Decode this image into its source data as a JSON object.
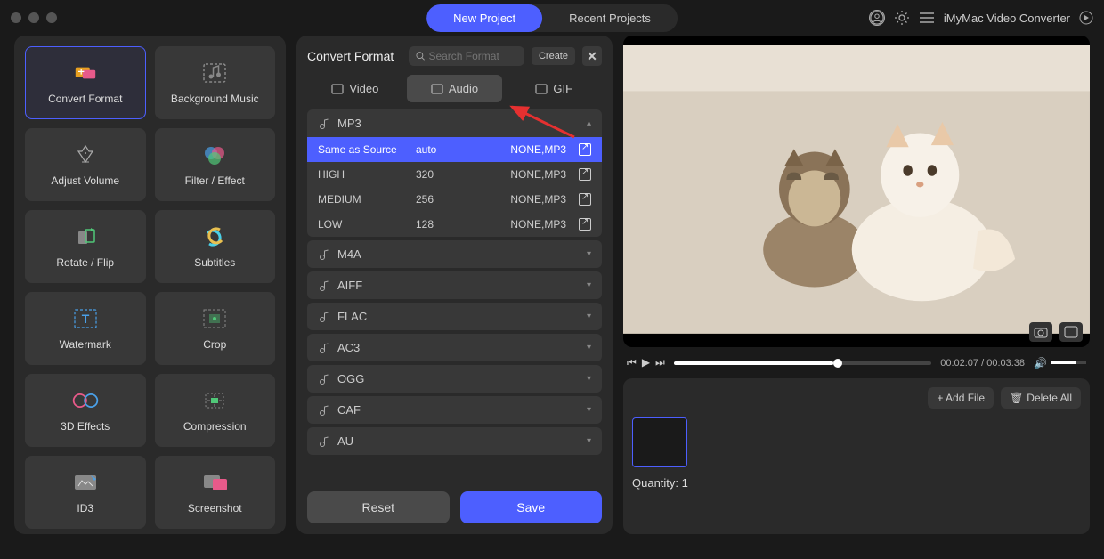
{
  "titlebar": {
    "new_project": "New Project",
    "recent_projects": "Recent Projects",
    "app_name": "iMyMac Video Converter"
  },
  "tools": [
    {
      "label": "Convert Format",
      "name": "convert-format"
    },
    {
      "label": "Background Music",
      "name": "background-music"
    },
    {
      "label": "Adjust Volume",
      "name": "adjust-volume"
    },
    {
      "label": "Filter / Effect",
      "name": "filter-effect"
    },
    {
      "label": "Rotate / Flip",
      "name": "rotate-flip"
    },
    {
      "label": "Subtitles",
      "name": "subtitles"
    },
    {
      "label": "Watermark",
      "name": "watermark"
    },
    {
      "label": "Crop",
      "name": "crop"
    },
    {
      "label": "3D Effects",
      "name": "3d-effects"
    },
    {
      "label": "Compression",
      "name": "compression"
    },
    {
      "label": "ID3",
      "name": "id3"
    },
    {
      "label": "Screenshot",
      "name": "screenshot"
    }
  ],
  "format_panel": {
    "title": "Convert Format",
    "search_placeholder": "Search Format",
    "create": "Create",
    "tabs": {
      "video": "Video",
      "audio": "Audio",
      "gif": "GIF"
    },
    "groups": [
      "MP3",
      "M4A",
      "AIFF",
      "FLAC",
      "AC3",
      "OGG",
      "CAF",
      "AU"
    ],
    "mp3_rows": [
      {
        "preset": "Same as Source",
        "bitrate": "auto",
        "codec": "NONE,MP3"
      },
      {
        "preset": "HIGH",
        "bitrate": "320",
        "codec": "NONE,MP3"
      },
      {
        "preset": "MEDIUM",
        "bitrate": "256",
        "codec": "NONE,MP3"
      },
      {
        "preset": "LOW",
        "bitrate": "128",
        "codec": "NONE,MP3"
      }
    ],
    "reset": "Reset",
    "save": "Save"
  },
  "player": {
    "time_current": "00:02:07",
    "time_total": "00:03:38"
  },
  "filebar": {
    "add_file": "+ Add File",
    "delete_all": "Delete All",
    "quantity_label": "Quantity:",
    "quantity_value": "1"
  }
}
